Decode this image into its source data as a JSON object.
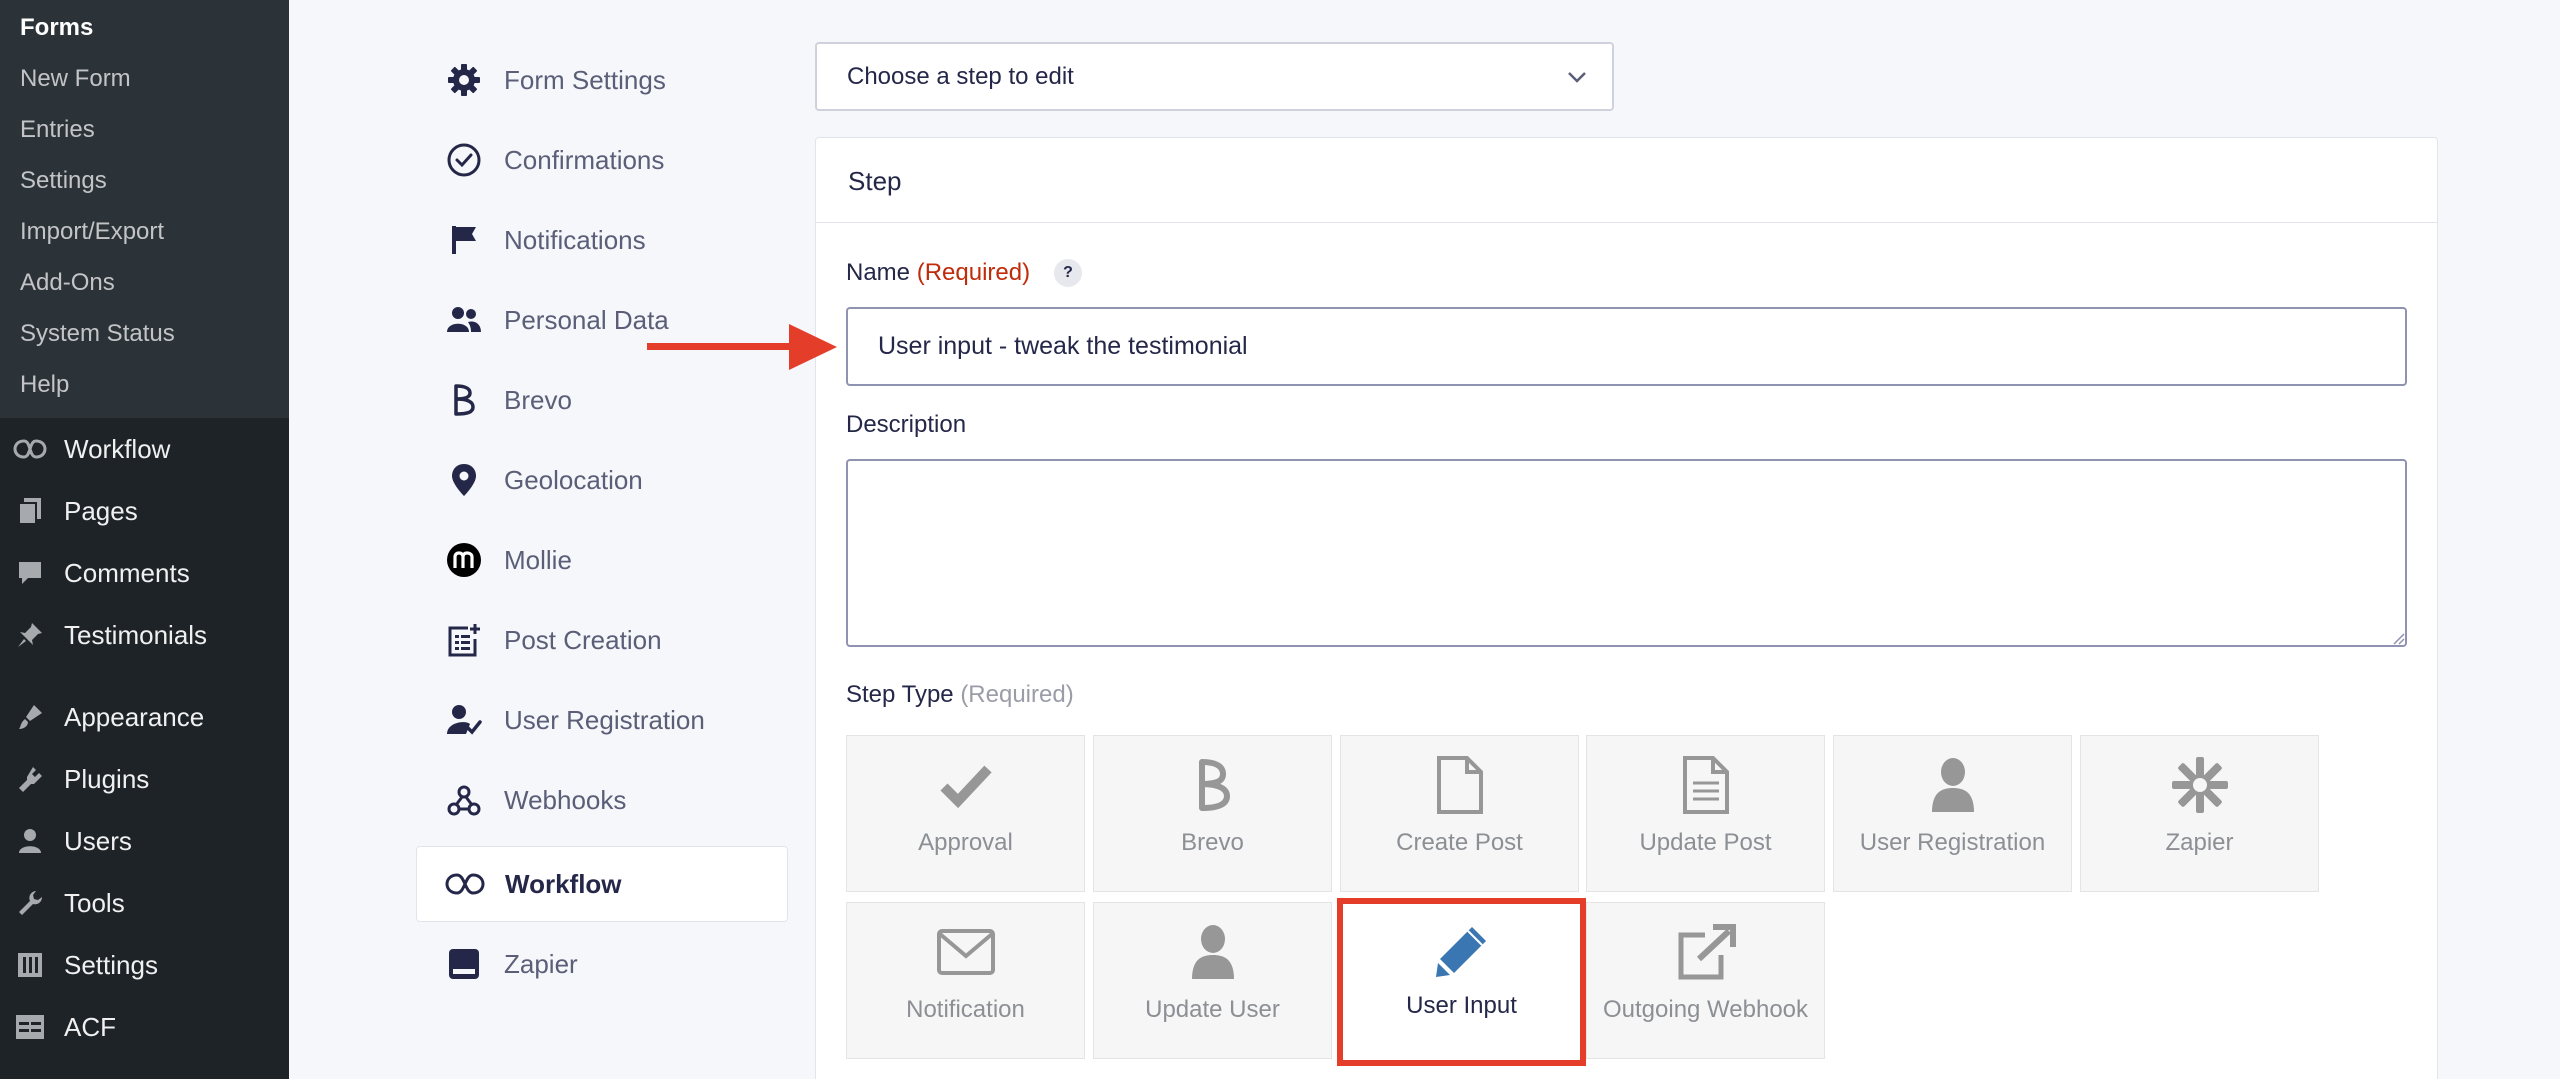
{
  "wp_menu": {
    "forms_submenu": [
      "Forms",
      "New Form",
      "Entries",
      "Settings",
      "Import/Export",
      "Add-Ons",
      "System Status",
      "Help"
    ],
    "main": [
      {
        "label": "Workflow",
        "icon": "workflow-icon"
      },
      {
        "label": "Pages",
        "icon": "pages-icon"
      },
      {
        "label": "Comments",
        "icon": "comments-icon"
      },
      {
        "label": "Testimonials",
        "icon": "pin-icon"
      },
      {
        "label": "Appearance",
        "icon": "appearance-icon"
      },
      {
        "label": "Plugins",
        "icon": "plugins-icon"
      },
      {
        "label": "Users",
        "icon": "users-icon"
      },
      {
        "label": "Tools",
        "icon": "tools-icon"
      },
      {
        "label": "Settings",
        "icon": "settings-icon"
      },
      {
        "label": "ACF",
        "icon": "acf-icon"
      }
    ]
  },
  "settings_nav": [
    {
      "label": "Form Settings",
      "icon": "gear-icon"
    },
    {
      "label": "Confirmations",
      "icon": "check-circle-icon"
    },
    {
      "label": "Notifications",
      "icon": "flag-icon"
    },
    {
      "label": "Personal Data",
      "icon": "people-icon"
    },
    {
      "label": "Brevo",
      "icon": "brevo-icon"
    },
    {
      "label": "Geolocation",
      "icon": "map-pin-icon"
    },
    {
      "label": "Mollie",
      "icon": "mollie-icon"
    },
    {
      "label": "Post Creation",
      "icon": "post-creation-icon"
    },
    {
      "label": "User Registration",
      "icon": "user-registration-icon"
    },
    {
      "label": "Webhooks",
      "icon": "webhooks-icon"
    },
    {
      "label": "Workflow",
      "icon": "workflow-icon",
      "active": true
    },
    {
      "label": "Zapier",
      "icon": "zapier-icon"
    }
  ],
  "step_select": {
    "label": "Choose a step to edit"
  },
  "step": {
    "title": "Step",
    "name_label": "Name",
    "name_required": "(Required)",
    "help": "?",
    "name_value": "User input - tweak the testimonial",
    "description_label": "Description",
    "description_value": "",
    "type_label": "Step Type",
    "type_required": "(Required)",
    "types": [
      {
        "label": "Approval",
        "icon": "checkmark-icon"
      },
      {
        "label": "Brevo",
        "icon": "brevo-icon"
      },
      {
        "label": "Create Post",
        "icon": "file-icon"
      },
      {
        "label": "Update Post",
        "icon": "file-text-icon"
      },
      {
        "label": "User Registration",
        "icon": "user-icon"
      },
      {
        "label": "Zapier",
        "icon": "zapier-icon"
      },
      {
        "label": "Notification",
        "icon": "envelope-icon"
      },
      {
        "label": "Update User",
        "icon": "user-icon"
      },
      {
        "label": "User Input",
        "icon": "pencil-icon",
        "selected": true
      },
      {
        "label": "Outgoing Webhook",
        "icon": "external-link-icon"
      }
    ]
  },
  "colors": {
    "wp_sidebar": "#1d2327",
    "wp_submenu": "#2c3338",
    "required": "#c02b0a",
    "highlight": "#e43e2b",
    "selected_icon": "#3a76b2"
  }
}
